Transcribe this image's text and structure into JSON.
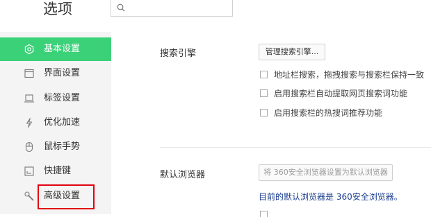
{
  "header": {
    "title": "选项",
    "search_placeholder": ""
  },
  "sidebar": {
    "items": [
      {
        "label": "基本设置",
        "icon": "gear-icon",
        "active": true
      },
      {
        "label": "界面设置",
        "icon": "window-icon"
      },
      {
        "label": "标签设置",
        "icon": "tab-icon"
      },
      {
        "label": "优化加速",
        "icon": "lightning-icon"
      },
      {
        "label": "鼠标手势",
        "icon": "mouse-icon"
      },
      {
        "label": "快捷键",
        "icon": "keyboard-icon"
      },
      {
        "label": "高级设置",
        "icon": "wrench-icon",
        "highlighted": true
      }
    ]
  },
  "search_engine": {
    "title": "搜索引擎",
    "manage_button": "管理搜索引擎...",
    "options": [
      {
        "label": "地址栏搜索，拖拽搜索与搜索栏保持一致",
        "checked": false
      },
      {
        "label": "启用搜索栏自动提取网页搜索词功能",
        "checked": false
      },
      {
        "label": "启用搜索栏的热搜词推荐功能",
        "checked": false
      }
    ]
  },
  "default_browser": {
    "title": "默认浏览器",
    "set_default_button": "将 360安全浏览器设置为默认浏览器",
    "current_note": "目前的默认浏览器是 360安全浏览器。"
  },
  "colors": {
    "accent": "#3bd178",
    "highlight_border": "#e3000f",
    "note_text": "#1a3d8f"
  }
}
